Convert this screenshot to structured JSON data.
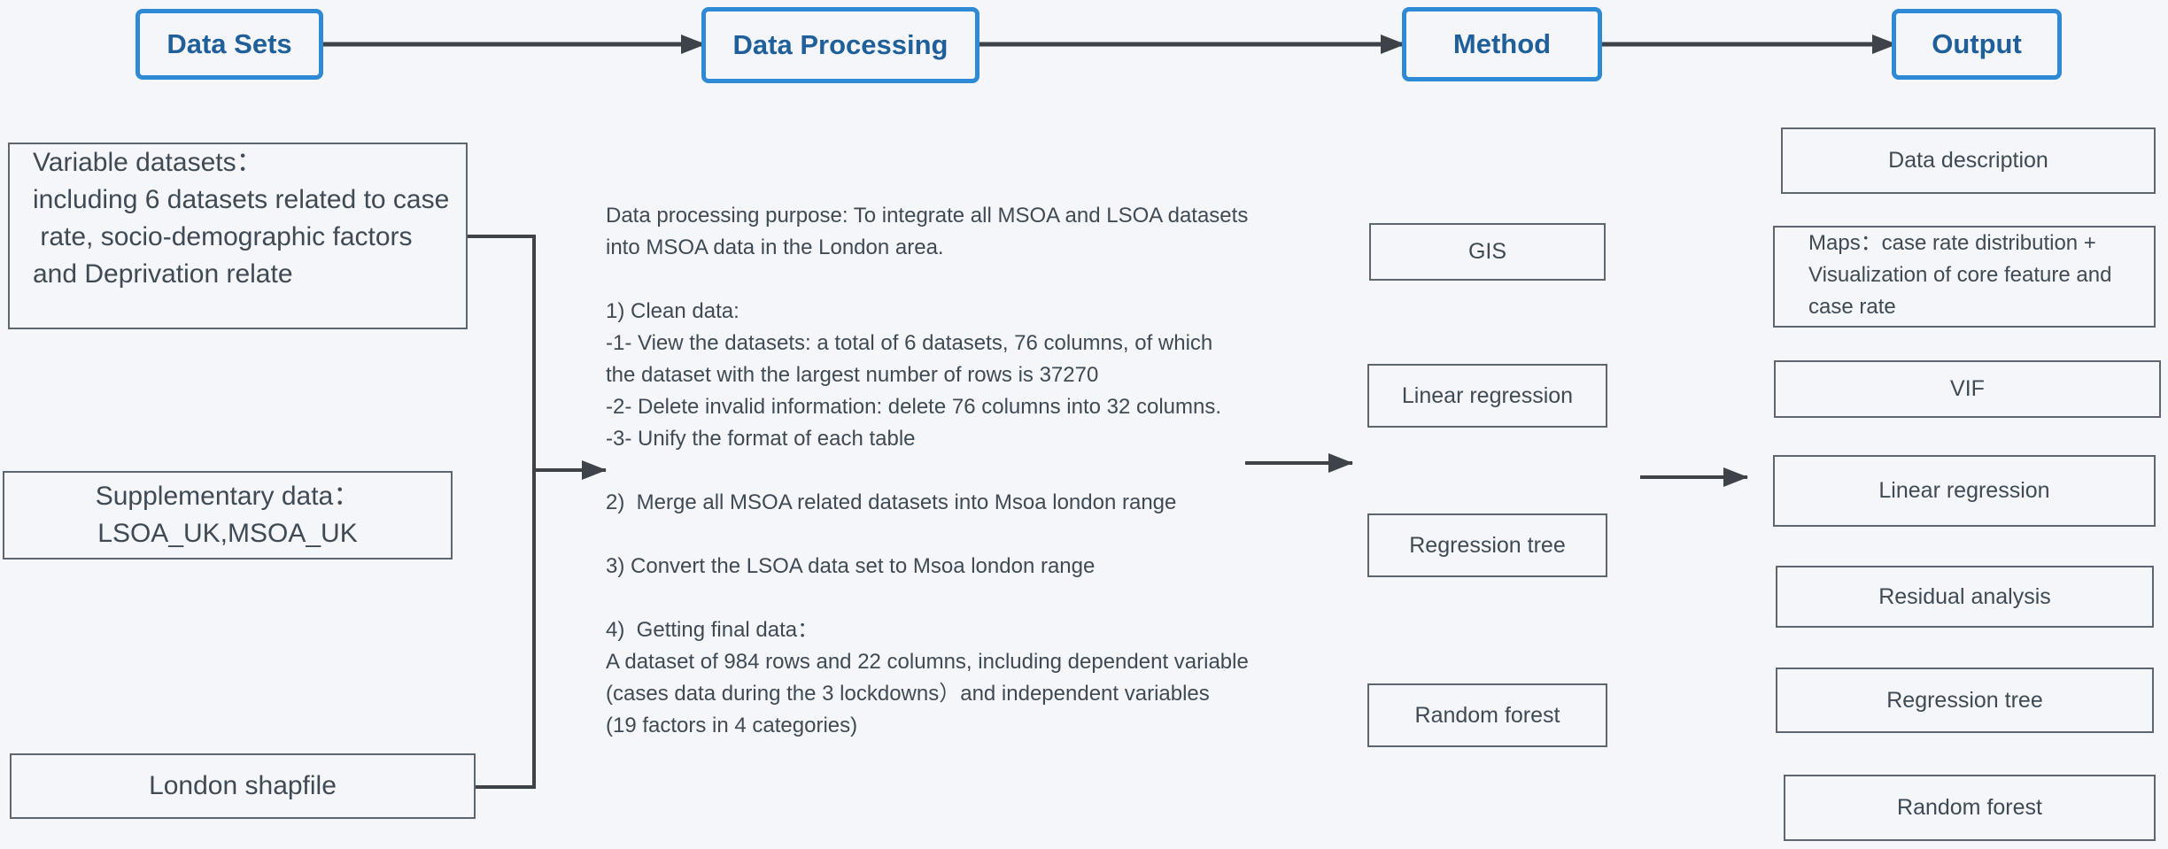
{
  "header": {
    "data_sets": "Data Sets",
    "data_processing": "Data Processing",
    "method": "Method",
    "output": "Output"
  },
  "data_sets": {
    "variable_line1": "Variable datasets：",
    "variable_line2": "including 6 datasets related to case",
    "variable_line3": " rate, socio-demographic factors",
    "variable_line4": "and Deprivation relate",
    "supplementary_line1": "Supplementary data：",
    "supplementary_line2": "LSOA_UK,MSOA_UK",
    "london_shapefile": "London shapfile"
  },
  "processing": {
    "lines": [
      "Data processing purpose: To integrate all MSOA and LSOA datasets",
      "into MSOA data in the London area.",
      "",
      "1) Clean data:",
      "-1- View the datasets: a total of 6 datasets, 76 columns, of which",
      "the dataset with the largest number of rows is 37270",
      "-2- Delete invalid information: delete 76 columns into 32 columns.",
      "-3- Unify the format of each table",
      "",
      "2)  Merge all MSOA related datasets into Msoa london range",
      "",
      "3) Convert the LSOA data set to Msoa london range",
      "",
      "4)  Getting final data：",
      "A dataset of 984 rows and 22 columns, including dependent variable",
      "(cases data during the 3 lockdowns）and independent variables",
      "(19 factors in 4 categories)"
    ]
  },
  "methods": {
    "gis": "GIS",
    "linear_regression": "Linear regression",
    "regression_tree": "Regression tree",
    "random_forest": "Random forest"
  },
  "outputs": {
    "data_description": "Data description",
    "maps_line1": "Maps：case rate distribution +",
    "maps_line2": "Visualization of core feature and",
    "maps_line3": "case rate",
    "vif": "VIF",
    "linear_regression": "Linear regression",
    "residual_analysis": "Residual analysis",
    "regression_tree": "Regression tree",
    "random_forest": "Random forest"
  },
  "colors": {
    "header_border": "#2f8ad6",
    "header_text": "#1f5f9a",
    "box_border": "#5d6670",
    "arrow": "#3d4349",
    "background": "#f4f6f9"
  }
}
